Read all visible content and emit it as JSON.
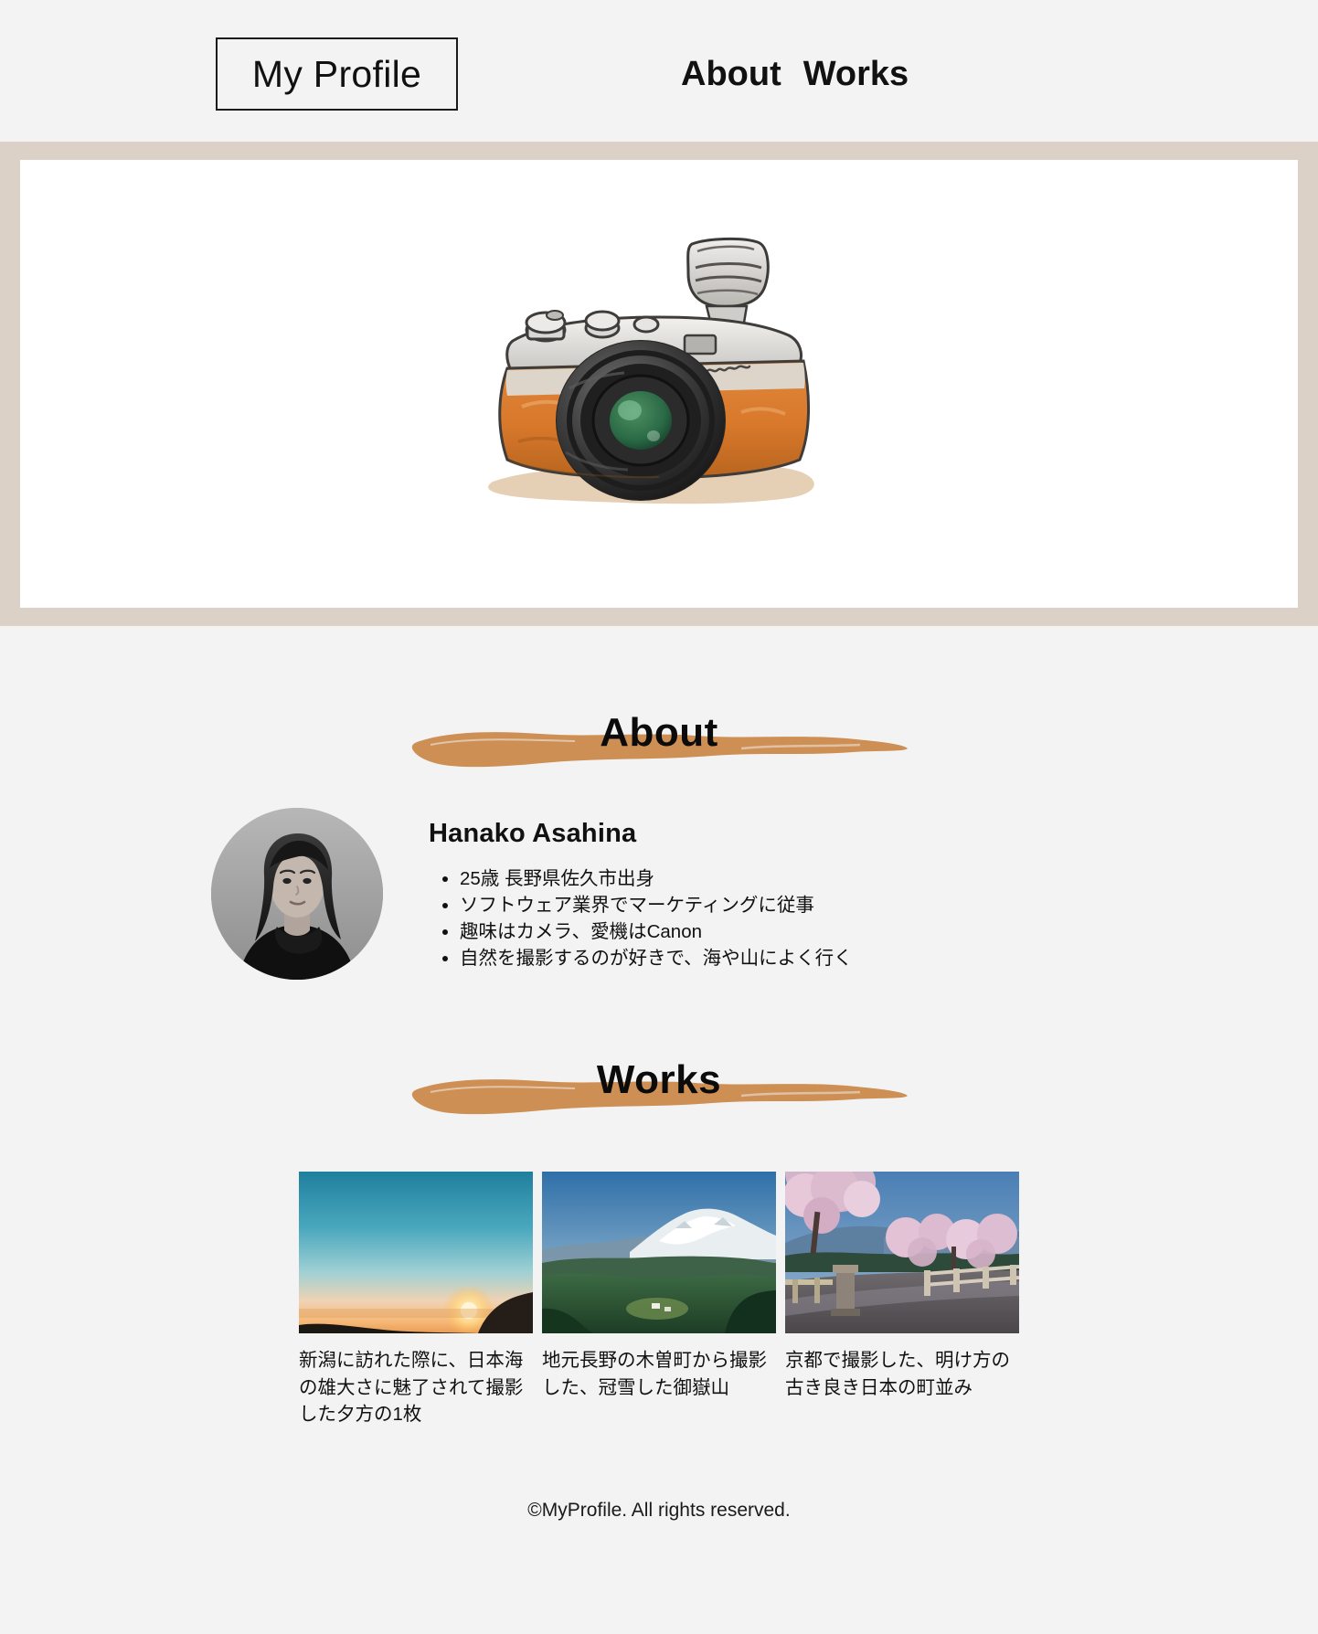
{
  "header": {
    "brand_label": "My Profile",
    "nav": [
      {
        "label": "About",
        "name": "nav-about"
      },
      {
        "label": "Works",
        "name": "nav-works"
      }
    ]
  },
  "hero": {
    "image_alt": "watercolor-vintage-camera-illustration",
    "band_color": "#dbd1c7",
    "panel_color": "#ffffff"
  },
  "about": {
    "heading": "About",
    "brush_color": "#cd8f54",
    "avatar_alt": "portrait-photo-of-hanako-asahina",
    "name": "Hanako Asahina",
    "facts": [
      "25歳 長野県佐久市出身",
      "ソフトウェア業界でマーケティングに従事",
      "趣味はカメラ、愛機はCanon",
      "自然を撮影するのが好きで、海や山によく行く"
    ]
  },
  "works": {
    "heading": "Works",
    "brush_color": "#cd8f54",
    "items": [
      {
        "image_alt": "sunset-over-the-sea-of-japan",
        "caption": "新潟に訪れた際に、日本海の雄大さに魅了されて撮影した夕方の1枚"
      },
      {
        "image_alt": "snow-capped-mount-ontake-from-kiso",
        "caption": "地元長野の木曽町から撮影した、冠雪した御嶽山"
      },
      {
        "image_alt": "cherry-blossoms-and-old-bridge-in-kyoto",
        "caption": "京都で撮影した、明け方の古き良き日本の町並み"
      }
    ]
  },
  "footer": {
    "copyright": "©MyProfile. All rights reserved."
  },
  "colors": {
    "page_background": "#f3f3f3",
    "hero_band": "#dbd1c7",
    "accent_brush": "#cd8f54",
    "text": "#111111"
  }
}
